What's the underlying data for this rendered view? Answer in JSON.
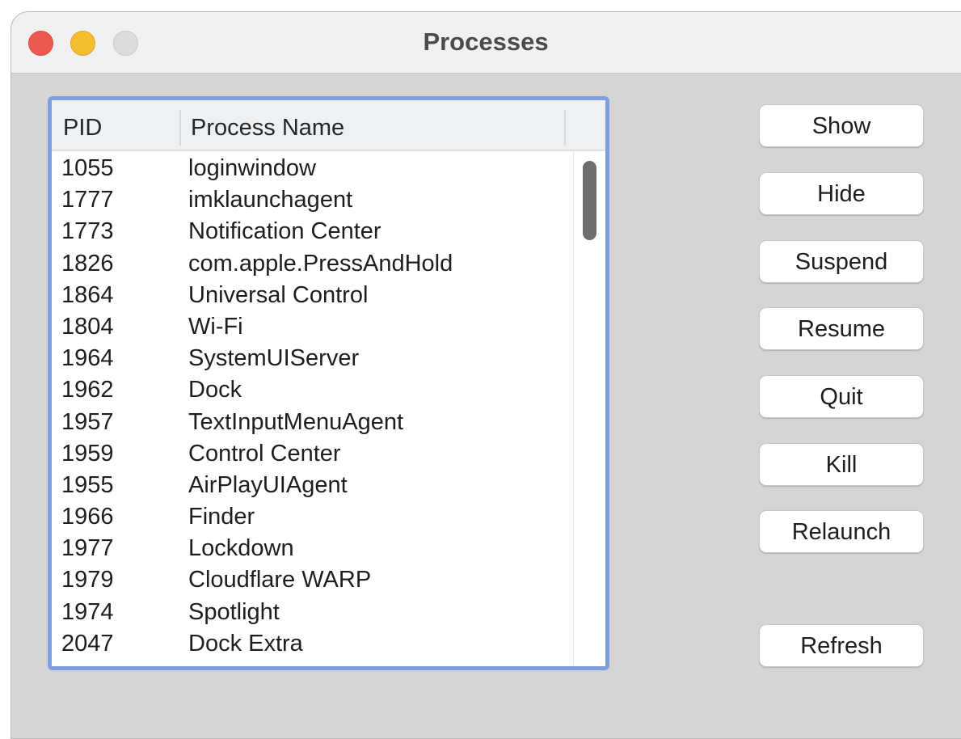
{
  "window": {
    "title": "Processes",
    "controls": [
      "close",
      "minimize",
      "zoom"
    ]
  },
  "table": {
    "columns": [
      "PID",
      "Process Name"
    ],
    "rows": [
      {
        "pid": "1055",
        "name": "loginwindow"
      },
      {
        "pid": "1777",
        "name": "imklaunchagent"
      },
      {
        "pid": "1773",
        "name": "Notification Center"
      },
      {
        "pid": "1826",
        "name": "com.apple.PressAndHold"
      },
      {
        "pid": "1864",
        "name": "Universal Control"
      },
      {
        "pid": "1804",
        "name": "Wi-Fi"
      },
      {
        "pid": "1964",
        "name": "SystemUIServer"
      },
      {
        "pid": "1962",
        "name": "Dock"
      },
      {
        "pid": "1957",
        "name": "TextInputMenuAgent"
      },
      {
        "pid": "1959",
        "name": "Control Center"
      },
      {
        "pid": "1955",
        "name": "AirPlayUIAgent"
      },
      {
        "pid": "1966",
        "name": "Finder"
      },
      {
        "pid": "1977",
        "name": "Lockdown"
      },
      {
        "pid": "1979",
        "name": "Cloudflare WARP"
      },
      {
        "pid": "1974",
        "name": "Spotlight"
      },
      {
        "pid": "2047",
        "name": "Dock Extra"
      }
    ]
  },
  "buttons": {
    "show": "Show",
    "hide": "Hide",
    "suspend": "Suspend",
    "resume": "Resume",
    "quit": "Quit",
    "kill": "Kill",
    "relaunch": "Relaunch",
    "refresh": "Refresh"
  },
  "colors": {
    "close": "#ee5a52",
    "minimize": "#f5bd30",
    "zoom_inactive": "#dcdcdc",
    "focus_ring": "#7d9fdf",
    "window_background": "#d5d5d5"
  }
}
